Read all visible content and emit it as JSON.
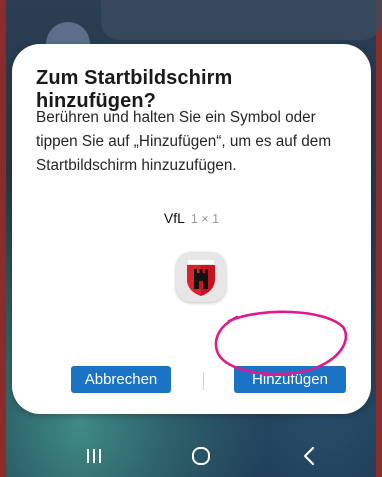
{
  "dialog": {
    "title": "Zum Startbildschirm hinzufügen?",
    "message": "Berühren und halten Sie ein Symbol oder tippen Sie auf „Hinzufügen“, um es auf dem Startbildschirm hinzuzufügen.",
    "widget_name": "VfL",
    "widget_size": "1 × 1",
    "widget_icon": "vfl-crest-icon",
    "cancel_label": "Abbrechen",
    "add_label": "Hinzufügen"
  },
  "nav": {
    "recents_icon": "recents-icon",
    "home_icon": "home-icon",
    "back_icon": "back-icon"
  },
  "colors": {
    "button": "#1a73c5",
    "annotation": "#e0198c",
    "dialog_bg": "#ffffff"
  }
}
